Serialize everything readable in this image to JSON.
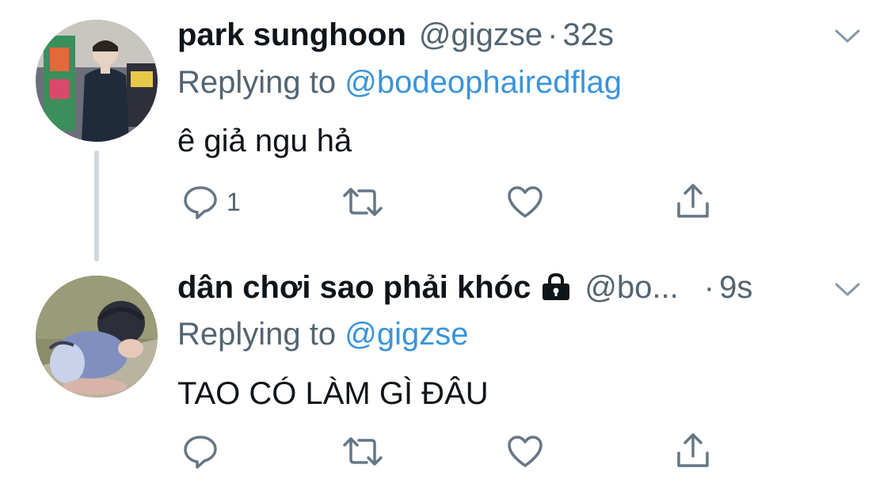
{
  "tweets": [
    {
      "display_name": "park sunghoon",
      "handle": "@gigzse",
      "separator": "·",
      "time": "32s",
      "replying_prefix": "Replying to",
      "replying_mention": "@bodeophairedflag",
      "text": "ê giả ngu hả",
      "reply_count": "1",
      "avatar_icon": "avatar-photo",
      "locked": false
    },
    {
      "display_name": "dân chơi sao phải khóc",
      "handle": "@bo...",
      "separator": "·",
      "time": "9s",
      "replying_prefix": "Replying to",
      "replying_mention": "@gigzse",
      "text": "TAO CÓ LÀM GÌ ĐÂU",
      "reply_count": "",
      "avatar_icon": "avatar-cartoon",
      "locked": true,
      "lock_icon": "lock-icon"
    }
  ],
  "icons": {
    "reply": "reply-icon",
    "retweet": "retweet-icon",
    "like": "like-icon",
    "share": "share-icon",
    "menu": "chevron-down-icon"
  },
  "colors": {
    "link": "#3b94d9",
    "secondary": "#536471",
    "primary": "#0f1419",
    "thread_line": "#cfd9de"
  }
}
